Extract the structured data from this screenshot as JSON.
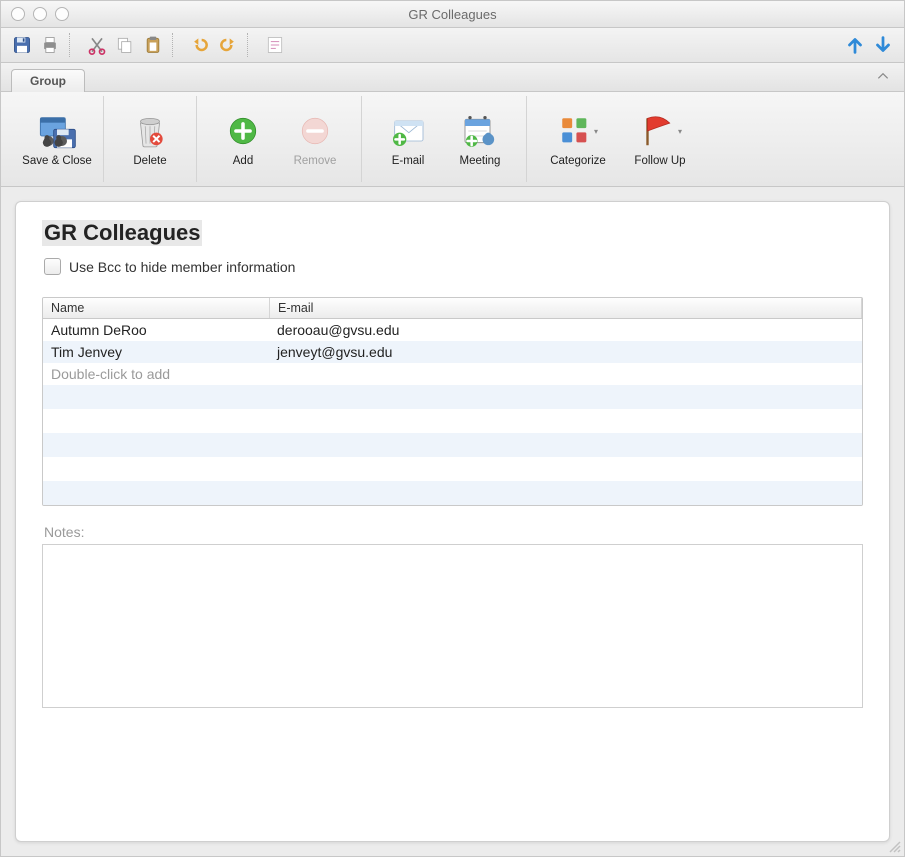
{
  "window": {
    "title": "GR Colleagues"
  },
  "tabs": {
    "group": "Group"
  },
  "ribbon": {
    "save_close": "Save & Close",
    "delete": "Delete",
    "add": "Add",
    "remove": "Remove",
    "email": "E-mail",
    "meeting": "Meeting",
    "categorize": "Categorize",
    "followup": "Follow Up"
  },
  "group": {
    "title": "GR Colleagues",
    "bcc_label": "Use Bcc to hide member information",
    "bcc_checked": false
  },
  "members": {
    "headers": {
      "name": "Name",
      "email": "E-mail"
    },
    "rows": [
      {
        "name": "Autumn DeRoo",
        "email": "derooau@gvsu.edu"
      },
      {
        "name": "Tim Jenvey",
        "email": "jenveyt@gvsu.edu"
      }
    ],
    "add_placeholder": "Double-click to add"
  },
  "notes": {
    "label": "Notes:",
    "value": ""
  }
}
